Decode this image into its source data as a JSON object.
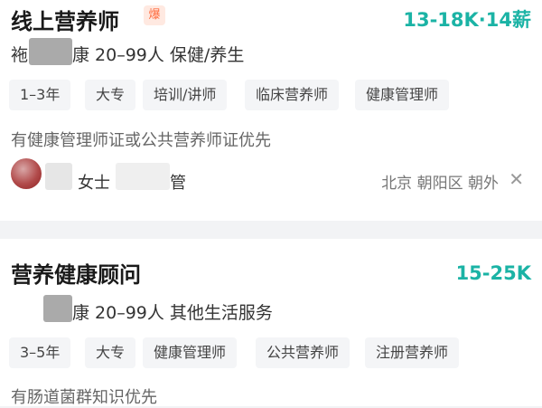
{
  "jobs": [
    {
      "title": "线上营养师",
      "badge": "爆",
      "salary": "13-18K·14薪",
      "company_prefix": "袘",
      "company_suffix": "康 20–99人 保健/养生",
      "tags": [
        "1–3年",
        "大专",
        "培训/讲师",
        "临床营养师",
        "健康管理师"
      ],
      "description": "有健康管理师证或公共营养师证优先",
      "recruiter_name": "女士",
      "recruiter_title": "管",
      "location": "北京 朝阳区 朝外",
      "close_icon": "close-icon"
    },
    {
      "title": "营养健康顾问",
      "salary": "15-25K",
      "company_suffix": "康 20–99人 其他生活服务",
      "tags": [
        "3–5年",
        "大专",
        "健康管理师",
        "公共营养师",
        "注册营养师"
      ],
      "description": "有肠道菌群知识优先"
    }
  ],
  "colors": {
    "salary": "#1bb3a5",
    "badge_text": "#ff6a3d",
    "badge_bg": "#ffe9e1",
    "tag_bg": "#f4f5f7",
    "page_bg": "#f2f3f5"
  }
}
